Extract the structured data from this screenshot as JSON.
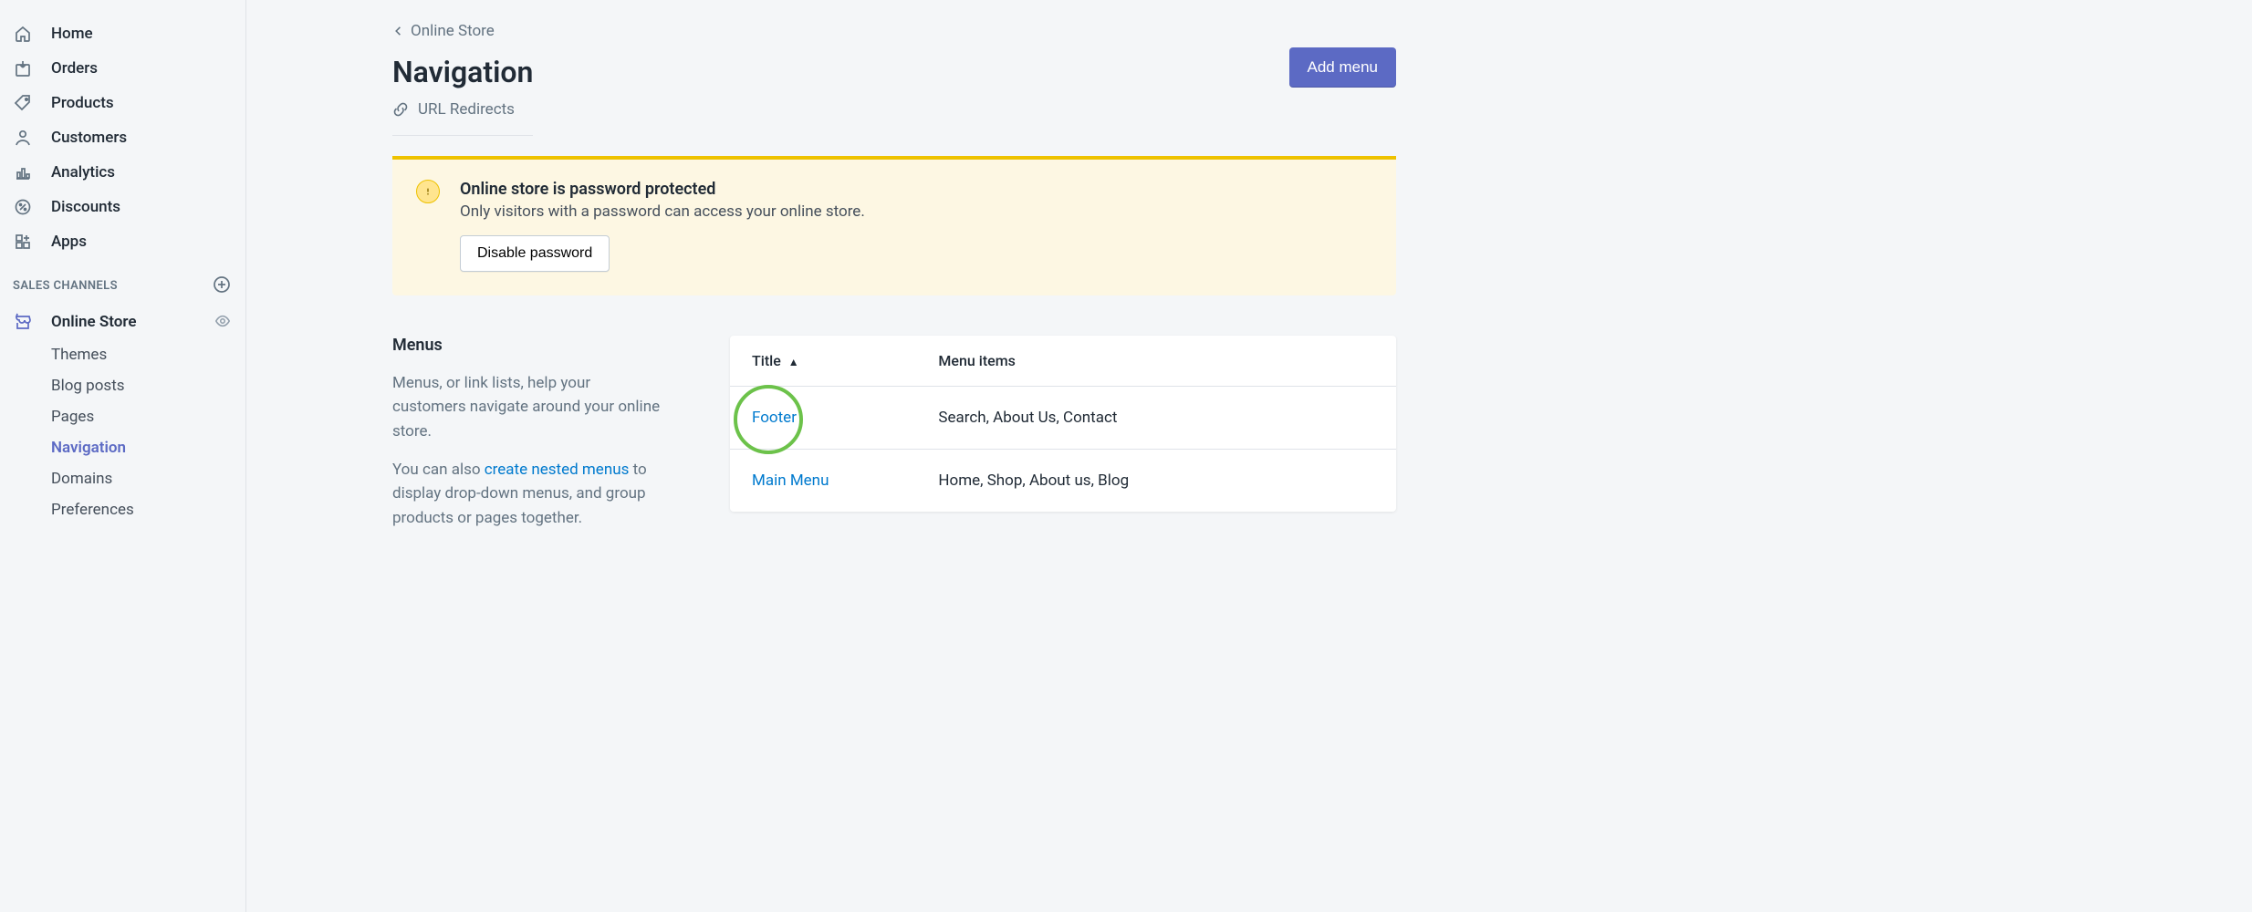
{
  "sidebar": {
    "items": [
      {
        "label": "Home"
      },
      {
        "label": "Orders"
      },
      {
        "label": "Products"
      },
      {
        "label": "Customers"
      },
      {
        "label": "Analytics"
      },
      {
        "label": "Discounts"
      },
      {
        "label": "Apps"
      }
    ],
    "section_label": "SALES CHANNELS",
    "channel": {
      "label": "Online Store"
    },
    "sub": [
      {
        "label": "Themes"
      },
      {
        "label": "Blog posts"
      },
      {
        "label": "Pages"
      },
      {
        "label": "Navigation",
        "selected": true
      },
      {
        "label": "Domains"
      },
      {
        "label": "Preferences"
      }
    ]
  },
  "header": {
    "breadcrumb": "Online Store",
    "title": "Navigation",
    "sublink": "URL Redirects",
    "add_button": "Add menu"
  },
  "banner": {
    "title": "Online store is password protected",
    "text": "Only visitors with a password can access your online store.",
    "button": "Disable password"
  },
  "menus_section": {
    "heading": "Menus",
    "para1": "Menus, or link lists, help your customers navigate around your online store.",
    "para2_a": "You can also ",
    "para2_link": "create nested menus",
    "para2_b": " to display drop-down menus, and group products or pages together."
  },
  "menus_table": {
    "col_title": "Title",
    "col_items": "Menu items",
    "rows": [
      {
        "title": "Footer",
        "items": "Search, About Us, Contact",
        "highlight": true
      },
      {
        "title": "Main Menu",
        "items": "Home, Shop, About us, Blog"
      }
    ]
  }
}
